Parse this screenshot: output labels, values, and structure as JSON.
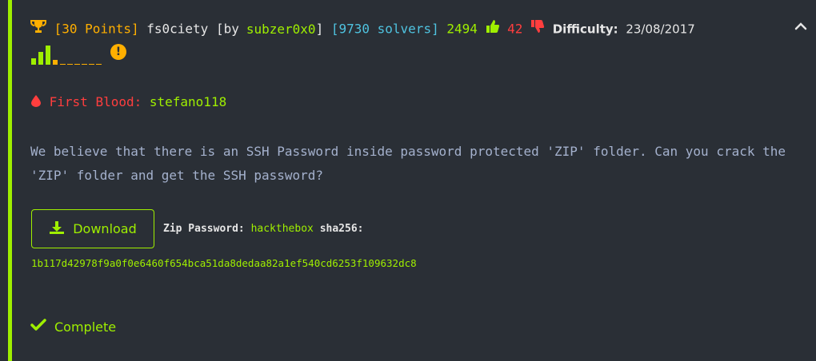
{
  "challenge": {
    "points": "[30 Points]",
    "name": "fs0ciety",
    "by_prefix": "[by",
    "author": "subzer0x0",
    "by_suffix": "]",
    "solvers": "[9730 solvers]",
    "likes": "2494",
    "dislikes": "42",
    "difficulty_label": "Difficulty:",
    "date": "23/08/2017",
    "warning_symbol": "!"
  },
  "difficulty_bars": [
    0.35,
    0.65,
    1.0,
    0.25,
    0.05,
    0.05,
    0.05,
    0.05,
    0.05,
    0.05
  ],
  "first_blood": {
    "label": "First Blood:",
    "user": "stefano118"
  },
  "description": "We believe that there is an SSH Password inside password protected 'ZIP' folder. Can you crack the 'ZIP' folder and get the SSH password?",
  "download": {
    "label": "Download",
    "zip_password_label": "Zip Password:",
    "zip_password": "hackthebox",
    "sha_label": "sha256:",
    "sha256": "1b117d42978f9a0f0e6460f654bca51da8dedaa82a1ef540cd6253f109632dc8"
  },
  "status": {
    "label": "Complete"
  },
  "icons": {
    "trophy": "trophy-icon",
    "thumbs_up": "thumbs-up-icon",
    "thumbs_down": "thumbs-down-icon",
    "chevron": "chevron-up-icon",
    "blood": "blood-drop-icon",
    "download": "download-icon",
    "check": "check-icon",
    "warning": "warning-icon"
  },
  "colors": {
    "accent": "#9fef00",
    "points": "#ffaf00",
    "solvers": "#4fc3e0",
    "dislike": "#ff3e3e",
    "background": "#2a2f36"
  }
}
